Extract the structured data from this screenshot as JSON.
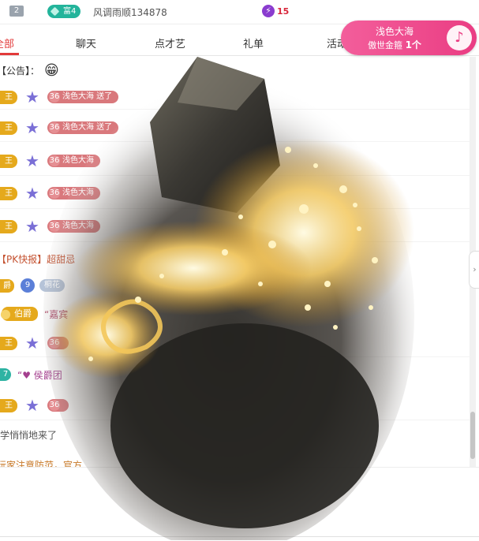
{
  "topbar": {
    "rank": "2",
    "fortune_badge": "富4",
    "username": "风调雨顺134878",
    "bolt_icon": "lightning-icon",
    "bolt_count": "15"
  },
  "gift_banner": {
    "sender": "浅色大海",
    "title_prefix": "傲世金箍",
    "title_count": "1个",
    "icon": "guitar-icon"
  },
  "tabs": [
    {
      "label": "全部",
      "active": true
    },
    {
      "label": "聊天",
      "active": false
    },
    {
      "label": "点才艺",
      "active": false
    },
    {
      "label": "礼单",
      "active": false
    },
    {
      "label": "活动",
      "active": false
    }
  ],
  "chat": {
    "announcement_label": "【公告】：",
    "king_badge": "王",
    "level_badge": "36",
    "row_texts": [
      "浅色大海 送了",
      "浅色大海 送了",
      "浅色大海",
      "浅色大海",
      "浅色大海"
    ],
    "pk_news": "【PK快报】超甜忌",
    "count_badge": "爵",
    "nine_badge": "9",
    "nine_name": "桐花",
    "earl_badge": "伯爵",
    "earl_quote": "“嘉宾",
    "marquis_badge": "7",
    "marquis_text": "“♥ 侯爵团",
    "someone_came": "学悄悄地来了",
    "warning": "玩家注意防范，官方"
  },
  "colors": {
    "accent_red": "#e23a3a",
    "banner_pink": "#ea3d83",
    "king_gold": "#e5a91c",
    "level_rose": "#d9787c"
  }
}
